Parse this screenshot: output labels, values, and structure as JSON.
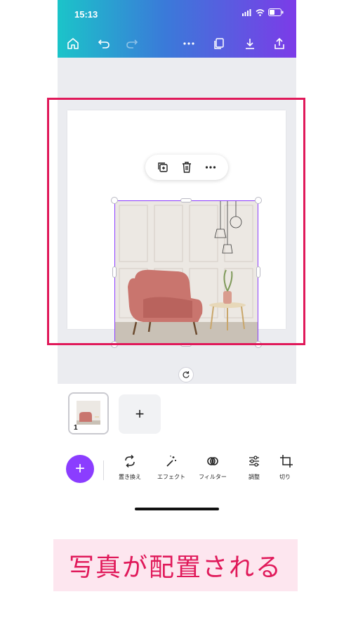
{
  "status_bar": {
    "time": "15:13"
  },
  "topbar": {
    "home": "home-icon",
    "undo": "undo-icon",
    "redo": "redo-icon",
    "more": "more-icon",
    "pages": "pages-icon",
    "download": "download-icon",
    "share": "share-icon",
    "gradient": [
      "#1bc4c9",
      "#7c3be8"
    ]
  },
  "context_menu": {
    "items": [
      "duplicate-icon",
      "delete-icon",
      "more-icon"
    ]
  },
  "page": {
    "number": "1"
  },
  "toolbar": {
    "add_label": "+",
    "tools": [
      {
        "icon": "replace-icon",
        "label": "置き換え"
      },
      {
        "icon": "effects-icon",
        "label": "エフェクト"
      },
      {
        "icon": "filter-icon",
        "label": "フィルター"
      },
      {
        "icon": "adjust-icon",
        "label": "調整"
      },
      {
        "icon": "crop-icon",
        "label": "切り"
      }
    ]
  },
  "add_page_label": "+",
  "caption": {
    "text": "写真が配置される"
  },
  "colors": {
    "accent": "#8b3dff",
    "highlight": "#e0195a",
    "caption_bg": "#fde6ef"
  }
}
